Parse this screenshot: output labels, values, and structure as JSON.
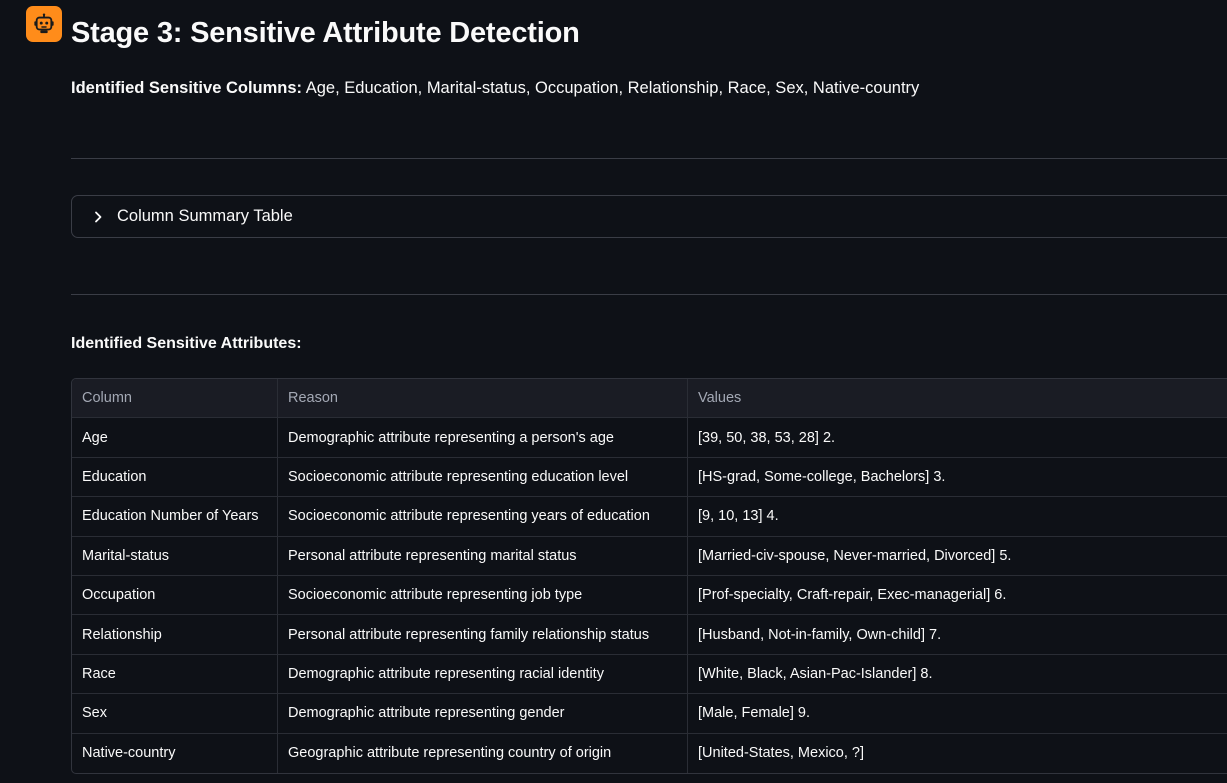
{
  "header": {
    "title": "Stage 3: Sensitive Attribute Detection",
    "sensitive_label": "Identified Sensitive Columns:",
    "sensitive_value": "Age, Education, Marital-status, Occupation, Relationship, Race, Sex, Native-country"
  },
  "expander": {
    "label": "Column Summary Table"
  },
  "attributes": {
    "heading": "Identified Sensitive Attributes:",
    "columns": [
      "Column",
      "Reason",
      "Values"
    ],
    "rows": [
      [
        "Age",
        "Demographic attribute representing a person's age",
        "[39, 50, 38, 53, 28] 2."
      ],
      [
        "Education",
        "Socioeconomic attribute representing education level",
        "[HS-grad, Some-college, Bachelors] 3."
      ],
      [
        "Education Number of Years",
        "Socioeconomic attribute representing years of education",
        "[9, 10, 13] 4."
      ],
      [
        "Marital-status",
        "Personal attribute representing marital status",
        "[Married-civ-spouse, Never-married, Divorced] 5."
      ],
      [
        "Occupation",
        "Socioeconomic attribute representing job type",
        "[Prof-specialty, Craft-repair, Exec-managerial] 6."
      ],
      [
        "Relationship",
        "Personal attribute representing family relationship status",
        "[Husband, Not-in-family, Own-child] 7."
      ],
      [
        "Race",
        "Demographic attribute representing racial identity",
        "[White, Black, Asian-Pac-Islander] 8."
      ],
      [
        "Sex",
        "Demographic attribute representing gender",
        "[Male, Female] 9."
      ],
      [
        "Native-country",
        "Geographic attribute representing country of origin",
        "[United-States, Mexico, ?]"
      ]
    ]
  },
  "icons": {
    "avatar": "robot-icon",
    "expander": "chevron-right-icon"
  },
  "colors": {
    "background": "#0e1117",
    "accent": "#ff8c1a",
    "text": "#fafafa"
  }
}
